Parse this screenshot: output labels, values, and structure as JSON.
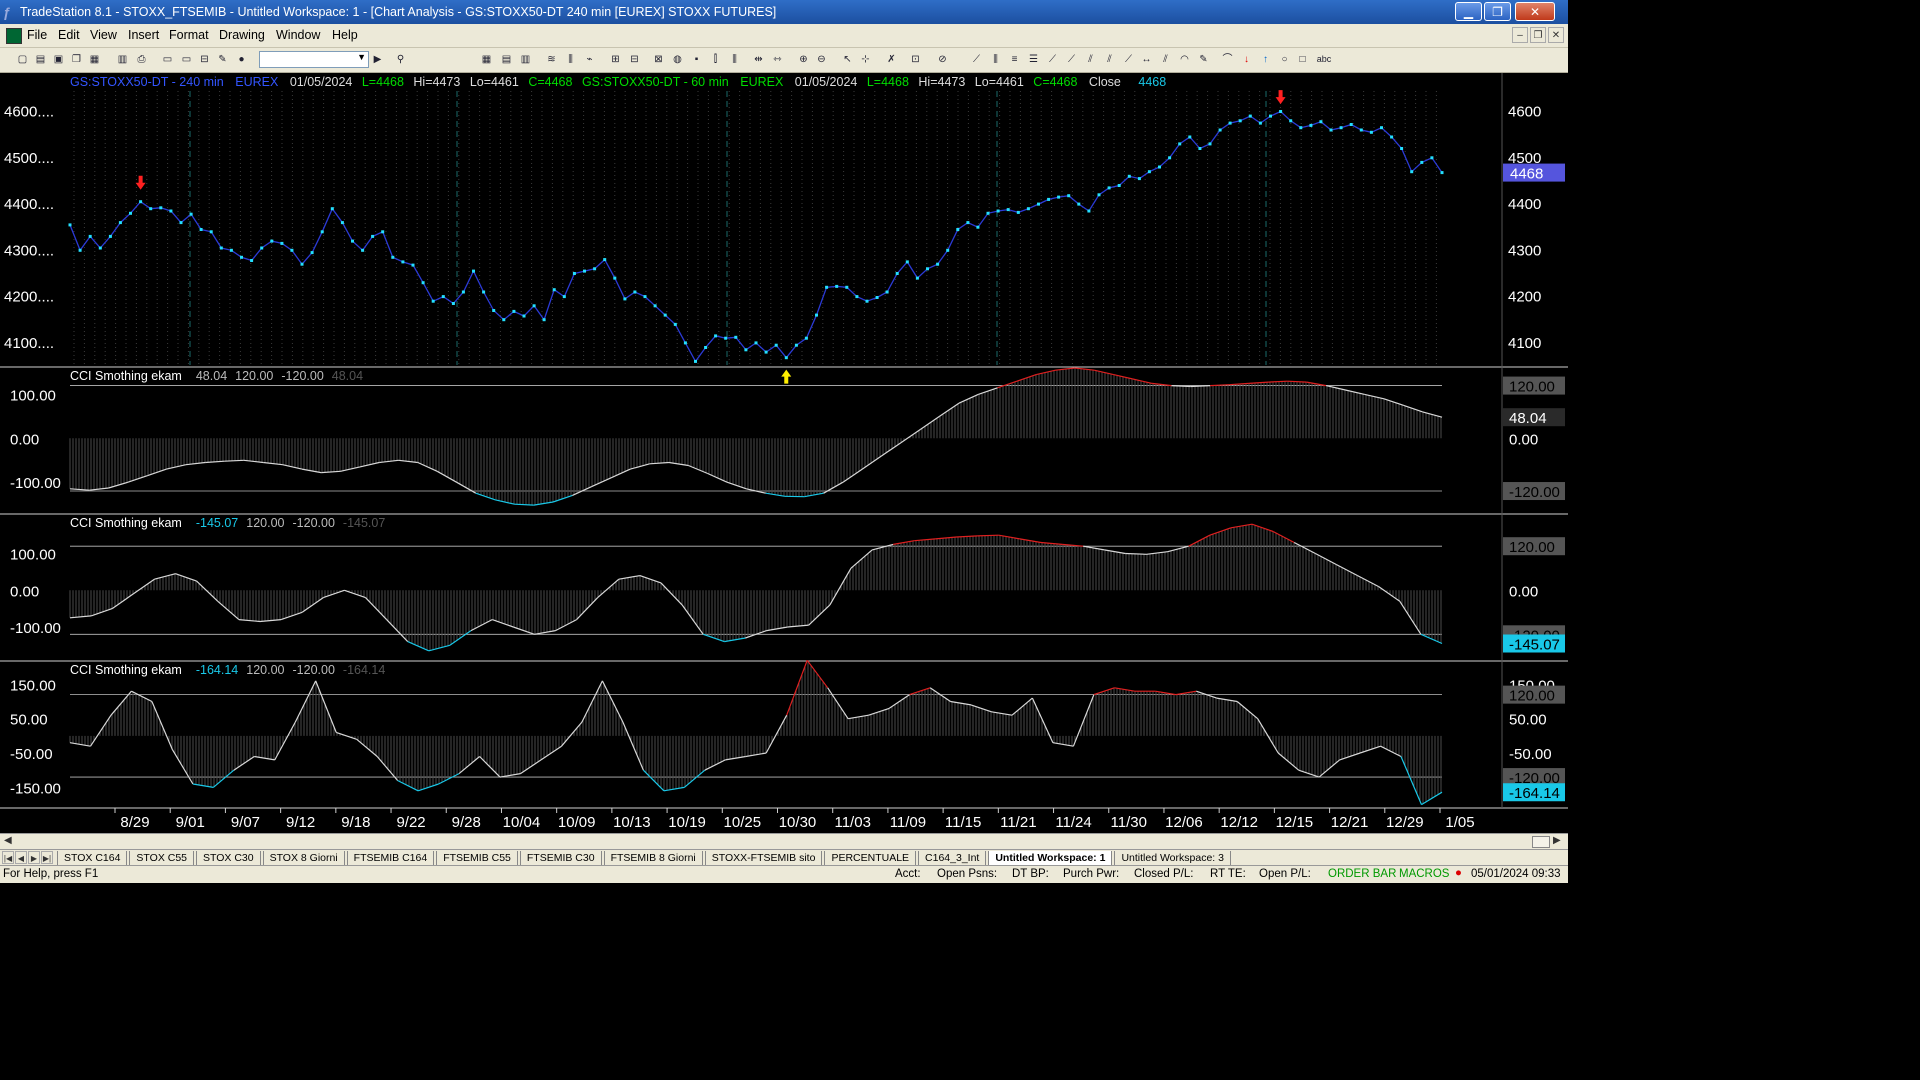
{
  "window": {
    "title": "TradeStation 8.1 - STOXX_FTSEMIB - Untitled Workspace:  1 - [Chart Analysis - GS:STOXX50-DT  240 min  [EUREX] STOXX FUTURES]",
    "minimize_icon": "minimize-icon",
    "maximize_icon": "maximize-icon",
    "close_icon": "close-icon"
  },
  "menu": {
    "items": [
      "File",
      "Edit",
      "View",
      "Insert",
      "Format",
      "Drawing",
      "Window",
      "Help"
    ]
  },
  "toolbar": {
    "symbol_value": "",
    "icons": [
      "new-icon",
      "open-icon",
      "save-icon",
      "print-icon",
      "zoom-in-icon",
      "zoom-out-icon",
      "cursor-icon",
      "trendline-icon",
      "arrow-down-icon",
      "arrow-up-icon",
      "ellipse-icon",
      "rectangle-icon",
      "text-icon"
    ]
  },
  "chart": {
    "header": {
      "sym1": "GS:STOXX50-DT - 240 min",
      "ex1": "EUREX",
      "date1": "01/05/2024",
      "l1": "L=4468",
      "hi1": "Hi=4473",
      "lo1": "Lo=4461",
      "c1": "C=4468",
      "sym2": "GS:STOXX50-DT - 60 min",
      "ex2": "EUREX",
      "date2": "01/05/2024",
      "l2": "L=4468",
      "hi2": "Hi=4473",
      "lo2": "Lo=4461",
      "c2": "C=4468",
      "close_label": "Close",
      "close_val": "4468"
    },
    "price_left_ticks": [
      "4600....",
      "4500....",
      "4400....",
      "4300....",
      "4200....",
      "4100...."
    ],
    "price_right_ticks": [
      "4600",
      "4500",
      "4400",
      "4300",
      "4200",
      "4100"
    ],
    "last_price": "4468",
    "x_labels": [
      "8/29",
      "9/01",
      "9/07",
      "9/12",
      "9/18",
      "9/22",
      "9/28",
      "10/04",
      "10/09",
      "10/13",
      "10/19",
      "10/25",
      "10/30",
      "11/03",
      "11/09",
      "11/15",
      "11/21",
      "11/24",
      "11/30",
      "12/06",
      "12/12",
      "12/15",
      "12/21",
      "12/29",
      "1/05"
    ],
    "cci_panels": [
      {
        "title": "CCI Smothing ekam",
        "value": "48.04",
        "upper": "120.00",
        "lower": "-120.00",
        "ghost": "48.04",
        "left_ticks": [
          "100.00",
          "0.00",
          "-100.00"
        ],
        "right_labels": [
          "120.00",
          "48.04",
          "0.00",
          "-120.00"
        ]
      },
      {
        "title": "CCI Smothing ekam",
        "value": "-145.07",
        "upper": "120.00",
        "lower": "-120.00",
        "ghost": "-145.07",
        "left_ticks": [
          "100.00",
          "0.00",
          "-100.00"
        ],
        "right_labels": [
          "120.00",
          "0.00",
          "-120.00",
          "-145.07"
        ]
      },
      {
        "title": "CCI Smothing ekam",
        "value": "-164.14",
        "upper": "120.00",
        "lower": "-120.00",
        "ghost": "-164.14",
        "left_ticks": [
          "150.00",
          "50.00",
          "-50.00",
          "-150.00"
        ],
        "right_labels": [
          "150.00",
          "120.00",
          "50.00",
          "-50.00",
          "-120.00",
          "-164.14"
        ]
      }
    ]
  },
  "tabs": {
    "items": [
      "STOX C164",
      "STOX C55",
      "STOX  C30",
      "STOX  8 Giorni",
      "FTSEMIB C164",
      "FTSEMIB C55",
      "FTSEMIB C30",
      "FTSEMIB  8 Giorni",
      "STOXX-FTSEMIB sito",
      "PERCENTUALE",
      "C164_3_Int",
      "Untitled Workspace:  1",
      "Untitled Workspace:  3"
    ],
    "active": "Untitled Workspace:  1"
  },
  "status": {
    "help": "For Help, press F1",
    "acct": "Acct:",
    "open_psns": "Open Psns:",
    "dt_bp": "DT BP:",
    "purch_pwr": "Purch Pwr:",
    "closed_pl": "Closed P/L:",
    "rt_te": "RT TE:",
    "open_pl": "Open P/L:",
    "order_bar": "ORDER BAR",
    "macros": "MACROS",
    "datetime": "05/01/2024 09:33"
  },
  "chart_data": [
    {
      "type": "line",
      "title": "GS:STOXX50-DT - 240 min",
      "ylim": [
        4050,
        4640
      ],
      "grid": false,
      "series": [
        {
          "name": "GS:STOXX50-DT - 240 min",
          "values": [
            4355,
            4300,
            4330,
            4305,
            4330,
            4360,
            4380,
            4405,
            4390,
            4392,
            4385,
            4360,
            4378,
            4345,
            4340,
            4305,
            4300,
            4285,
            4278,
            4305,
            4320,
            4315,
            4300,
            4270,
            4295,
            4340,
            4390,
            4360,
            4320,
            4300,
            4330,
            4340,
            4285,
            4275,
            4268,
            4230,
            4190,
            4200,
            4185,
            4210,
            4255,
            4210,
            4170,
            4150,
            4168,
            4158,
            4180,
            4150,
            4215,
            4200,
            4250,
            4255,
            4260,
            4280,
            4240,
            4195,
            4210,
            4200,
            4180,
            4160,
            4140,
            4100,
            4060,
            4090,
            4115,
            4110,
            4112,
            4085,
            4100,
            4080,
            4095,
            4068,
            4095,
            4110,
            4160,
            4220,
            4222,
            4220,
            4200,
            4190,
            4198,
            4210,
            4250,
            4275,
            4240,
            4260,
            4270,
            4300,
            4345,
            4360,
            4350,
            4380,
            4385,
            4388,
            4382,
            4390,
            4400,
            4410,
            4415,
            4418,
            4400,
            4385,
            4420,
            4435,
            4440,
            4460,
            4455,
            4470,
            4480,
            4500,
            4530,
            4545,
            4520,
            4530,
            4560,
            4575,
            4580,
            4590,
            4575,
            4590,
            4600,
            4580,
            4565,
            4570,
            4578,
            4560,
            4565,
            4572,
            4560,
            4555,
            4565,
            4545,
            4520,
            4470,
            4490,
            4500,
            4468
          ]
        }
      ]
    },
    {
      "type": "area",
      "title": "CCI Smothing ekam",
      "ylim": [
        -170,
        160
      ],
      "thresholds": [
        120,
        -120
      ],
      "series": [
        {
          "name": "CCI Smothing ekam",
          "values": [
            -115,
            -118,
            -113,
            -100,
            -85,
            -70,
            -60,
            -55,
            -52,
            -50,
            -55,
            -60,
            -70,
            -78,
            -75,
            -65,
            -55,
            -50,
            -55,
            -75,
            -100,
            -125,
            -140,
            -150,
            -152,
            -145,
            -130,
            -110,
            -90,
            -70,
            -58,
            -55,
            -62,
            -80,
            -100,
            -115,
            -125,
            -132,
            -133,
            -125,
            -100,
            -70,
            -40,
            -10,
            20,
            50,
            80,
            100,
            115,
            130,
            145,
            155,
            160,
            155,
            145,
            135,
            125,
            120,
            118,
            120,
            122,
            125,
            128,
            130,
            128,
            120,
            110,
            100,
            90,
            75,
            60,
            48.04
          ]
        }
      ]
    },
    {
      "type": "area",
      "title": "CCI Smothing ekam",
      "ylim": [
        -190,
        205
      ],
      "thresholds": [
        120,
        -120
      ],
      "series": [
        {
          "name": "CCI Smothing ekam",
          "values": [
            -75,
            -70,
            -50,
            -10,
            30,
            45,
            25,
            -30,
            -80,
            -85,
            -80,
            -60,
            -20,
            0,
            -20,
            -80,
            -140,
            -165,
            -150,
            -110,
            -80,
            -100,
            -120,
            -110,
            -80,
            -20,
            30,
            40,
            20,
            -40,
            -120,
            -140,
            -130,
            -110,
            -100,
            -95,
            -40,
            60,
            110,
            125,
            135,
            140,
            145,
            148,
            150,
            140,
            130,
            125,
            120,
            110,
            100,
            98,
            105,
            120,
            150,
            170,
            180,
            160,
            130,
            100,
            70,
            40,
            10,
            -30,
            -120,
            -145.07
          ]
        }
      ]
    },
    {
      "type": "area",
      "title": "CCI Smothing ekam",
      "ylim": [
        -210,
        215
      ],
      "thresholds": [
        120,
        -120
      ],
      "series": [
        {
          "name": "CCI Smothing ekam",
          "values": [
            -20,
            -30,
            60,
            130,
            100,
            -40,
            -140,
            -150,
            -100,
            -60,
            -70,
            40,
            160,
            10,
            -10,
            -60,
            -130,
            -160,
            -140,
            -110,
            -60,
            -120,
            -110,
            -70,
            -30,
            40,
            160,
            40,
            -100,
            -160,
            -150,
            -100,
            -70,
            -60,
            -50,
            60,
            220,
            140,
            50,
            60,
            80,
            120,
            140,
            100,
            90,
            70,
            60,
            110,
            -20,
            -30,
            120,
            140,
            130,
            130,
            120,
            130,
            110,
            100,
            50,
            -50,
            -100,
            -120,
            -70,
            -50,
            -30,
            -60,
            -200,
            -164.14
          ]
        }
      ]
    }
  ]
}
